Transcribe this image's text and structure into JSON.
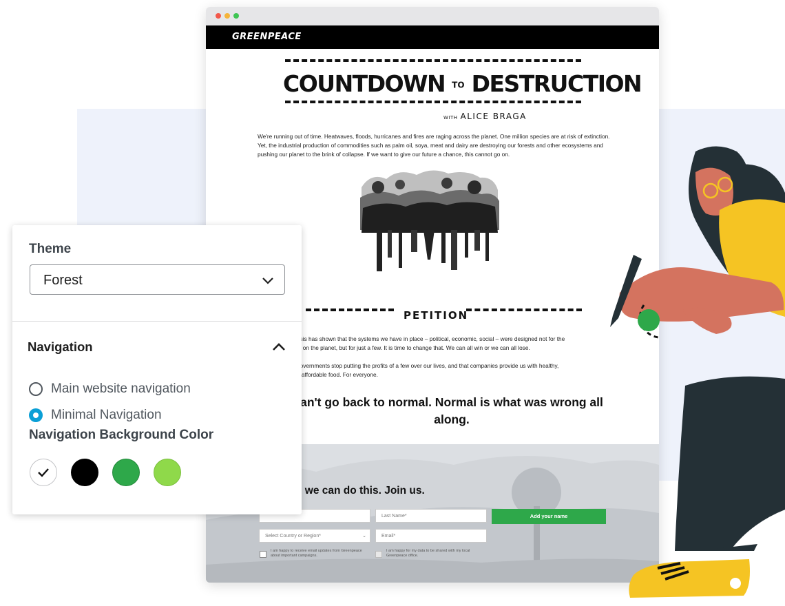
{
  "browser": {
    "site_logo": "GREENPEACE",
    "hero": {
      "title_main": "COUNTDOWN",
      "title_to": "TO",
      "title_end": "DESTRUCTION",
      "with_label": "WITH",
      "with_name": "ALICE BRAGA"
    },
    "intro_text": "We're running out of time. Heatwaves, floods, hurricanes and fires are raging across the planet. One million species are at risk of extinction. Yet, the industrial production of commodities such as palm oil, soya, meat and dairy are destroying our forests and other ecosystems and pushing our planet to the brink of collapse. If we want to give our future a chance, this cannot go on.",
    "petition_heading": "PETITION",
    "petition_text_1a": "risis has shown that the systems we have in place – political, economic, social – were designed not for the",
    "petition_text_1b": "le on the planet, but for just a few. It is time to change that. We can all win or we can all lose.",
    "petition_text_2a": "governments stop putting the profits of a few over our lives, and that companies provide us with healthy,",
    "petition_text_2b": "d affordable food. For everyone.",
    "quote": "an't go back to normal. Normal is what was wrong all along.",
    "form": {
      "join_heading": "r, we can do this. Join us.",
      "last_name_placeholder": "Last Name*",
      "country_placeholder": "Select Country or Region*",
      "email_placeholder": "Email*",
      "submit_label": "Add your name",
      "consent_1": "I am happy to receive email updates from Greenpeace about important campaigns.",
      "consent_2": "I am happy for my data to be shared with my local Greenpeace office."
    }
  },
  "settings": {
    "theme_label": "Theme",
    "theme_value": "Forest",
    "navigation_title": "Navigation",
    "navigation_options": [
      {
        "label": "Main website navigation",
        "selected": false
      },
      {
        "label": "Minimal Navigation",
        "selected": true
      }
    ],
    "bg_color_label": "Navigation Background Color",
    "swatches": [
      "#ffffff",
      "#000000",
      "#2ea84a",
      "#8fd94a"
    ],
    "selected_swatch": "#ffffff"
  },
  "colors": {
    "accent_green": "#2ea84a",
    "radio_blue": "#0a9fd6",
    "illustration_skin": "#d4735f",
    "illustration_shirt": "#f5c423",
    "illustration_dark": "#243036"
  }
}
